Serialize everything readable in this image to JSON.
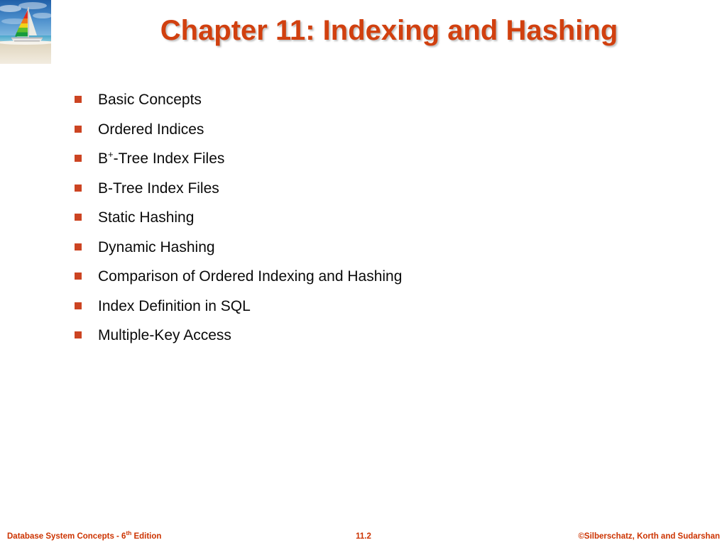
{
  "slide": {
    "title": "Chapter 11:  Indexing and Hashing",
    "title_color": "#d1400f",
    "background_color": "#ffffff",
    "bullet_color": "#cc4422",
    "body_text_color": "#0a0a0a"
  },
  "header": {
    "photo": {
      "name": "beach-catamaran-photo",
      "description": "Beach scene with rainbow-sailed catamaran on sand under blue sky"
    }
  },
  "content": {
    "bullets": [
      {
        "label": "Basic Concepts"
      },
      {
        "label": "Ordered Indices"
      },
      {
        "label": "B",
        "sup": "+",
        "label_tail": "-Tree Index Files"
      },
      {
        "label": "B-Tree Index Files"
      },
      {
        "label": "Static Hashing"
      },
      {
        "label": "Dynamic Hashing"
      },
      {
        "label": "Comparison of Ordered Indexing and Hashing"
      },
      {
        "label": "Index Definition in SQL"
      },
      {
        "label": "Multiple-Key Access"
      }
    ]
  },
  "footer": {
    "left_prefix": "Database System Concepts - 6",
    "left_sup": "th",
    "left_suffix": " Edition",
    "center": "11.2",
    "right": "©Silberschatz, Korth and Sudarshan",
    "color": "#cc3300"
  }
}
